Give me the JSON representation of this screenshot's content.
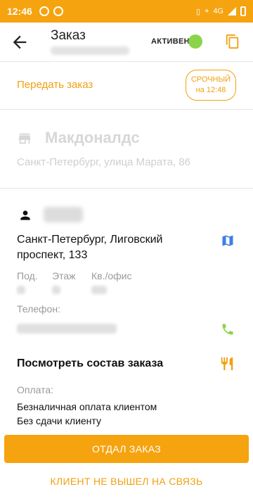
{
  "status_bar": {
    "time": "12:46",
    "network": "4G"
  },
  "header": {
    "title": "Заказ",
    "status": "АКТИВЕН"
  },
  "transfer": {
    "link": "Передать заказ",
    "urgent_line1": "СРОЧНЫЙ",
    "urgent_line2": "на 12:48"
  },
  "restaurant": {
    "name": "Макдоналдс",
    "address": "Санкт-Петербург, улица Марата, 86"
  },
  "client": {
    "address": "Санкт-Петербург, Лиговский проспект, 133",
    "entrance_label": "Под.",
    "floor_label": "Этаж",
    "apartment_label": "Кв./офис",
    "phone_label": "Телефон:"
  },
  "order": {
    "view_label": "Посмотреть состав заказа"
  },
  "payment": {
    "label": "Оплата:",
    "method": "Безналичная оплата клиентом",
    "change": "Без сдачи клиенту"
  },
  "actions": {
    "primary": "ОТДАЛ ЗАКАЗ",
    "secondary": "КЛИЕНТ НЕ ВЫШЕЛ НА СВЯЗЬ"
  },
  "colors": {
    "accent": "#f5a30f",
    "status_active": "#8bd44a",
    "map_icon": "#3f7ee8",
    "phone_icon": "#8bd44a",
    "food_icon": "#f0a010"
  }
}
